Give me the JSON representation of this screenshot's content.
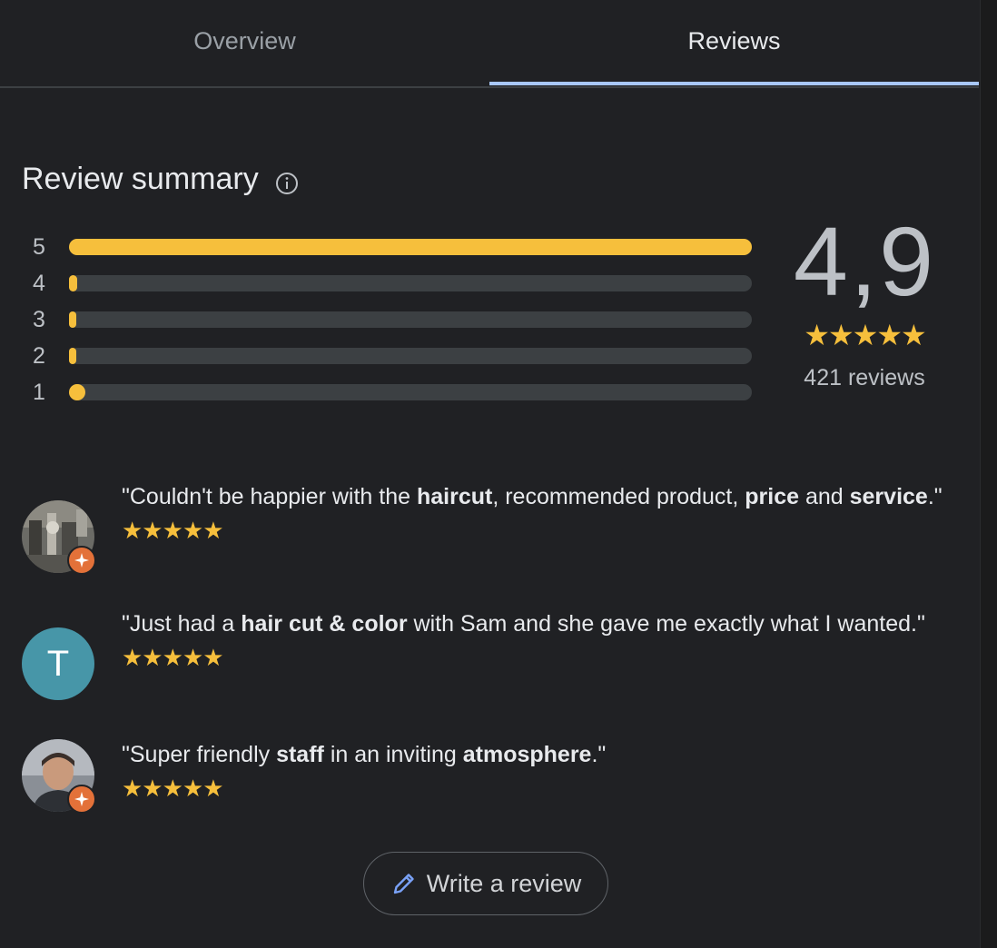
{
  "tabs": [
    {
      "label": "Overview",
      "active": false
    },
    {
      "label": "Reviews",
      "active": true
    }
  ],
  "summary": {
    "title": "Review summary",
    "info_icon": "info-icon",
    "distribution": [
      {
        "label": "5",
        "fraction": 1.0
      },
      {
        "label": "4",
        "fraction": 0.012
      },
      {
        "label": "3",
        "fraction": 0.004
      },
      {
        "label": "2",
        "fraction": 0.004
      },
      {
        "label": "1",
        "fraction": 0.024
      }
    ],
    "score": "4,9",
    "score_stars": "★★★★★",
    "review_count": "421 reviews"
  },
  "reviews": [
    {
      "avatar": "photo-avatar",
      "local_guide": true,
      "text_parts": [
        {
          "t": "\"Couldn't be happier with the ",
          "b": false
        },
        {
          "t": "haircut",
          "b": true
        },
        {
          "t": ", recommended product, ",
          "b": false
        },
        {
          "t": "price",
          "b": true
        },
        {
          "t": " and ",
          "b": false
        },
        {
          "t": "service",
          "b": true
        },
        {
          "t": ".\"",
          "b": false
        }
      ],
      "stars": "★★★★★"
    },
    {
      "avatar": "letter-avatar",
      "avatar_letter": "T",
      "avatar_color": "#4796a8",
      "local_guide": false,
      "text_parts": [
        {
          "t": "\"Just had a ",
          "b": false
        },
        {
          "t": "hair cut & color",
          "b": true
        },
        {
          "t": " with Sam and she gave me exactly what I wanted.\"",
          "b": false
        }
      ],
      "stars": "★★★★★"
    },
    {
      "avatar": "photo-avatar",
      "local_guide": true,
      "text_parts": [
        {
          "t": "\"Super friendly ",
          "b": false
        },
        {
          "t": "staff",
          "b": true
        },
        {
          "t": " in an inviting ",
          "b": false
        },
        {
          "t": "atmosphere",
          "b": true
        },
        {
          "t": ".\"",
          "b": false
        }
      ],
      "stars": "★★★★★"
    }
  ],
  "write_review": {
    "label": "Write a review",
    "icon": "pencil-icon"
  },
  "colors": {
    "background": "#202124",
    "star": "#f6bf3c",
    "track": "#3c4043",
    "active_tab_indicator": "#a8c7fa",
    "local_guide_badge": "#e37139"
  }
}
